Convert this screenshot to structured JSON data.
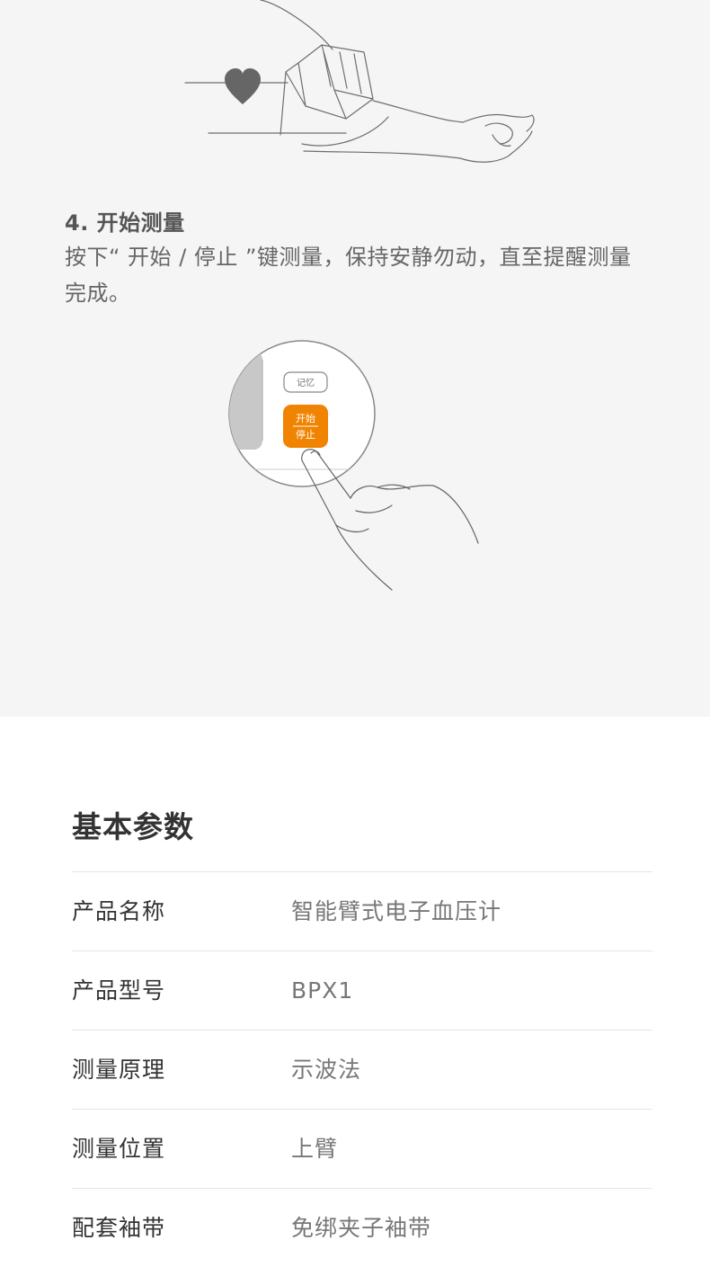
{
  "step": {
    "title": "4. 开始测量",
    "description": "按下“ 开始 / 停止 ”键测量，保持安静勿动，直至提醒测量完成。"
  },
  "device": {
    "memory_button_label": "记忆",
    "start_button_line1": "开始",
    "start_button_line2": "停止",
    "accent_color": "#f08300"
  },
  "specs": {
    "title": "基本参数",
    "rows": [
      {
        "key": "产品名称",
        "value": "智能臂式电子血压计"
      },
      {
        "key": "产品型号",
        "value": "BPX1"
      },
      {
        "key": "测量原理",
        "value": "示波法"
      },
      {
        "key": "测量位置",
        "value": "上臂"
      },
      {
        "key": "配套袖带",
        "value": "免绑夹子袖带"
      }
    ]
  }
}
